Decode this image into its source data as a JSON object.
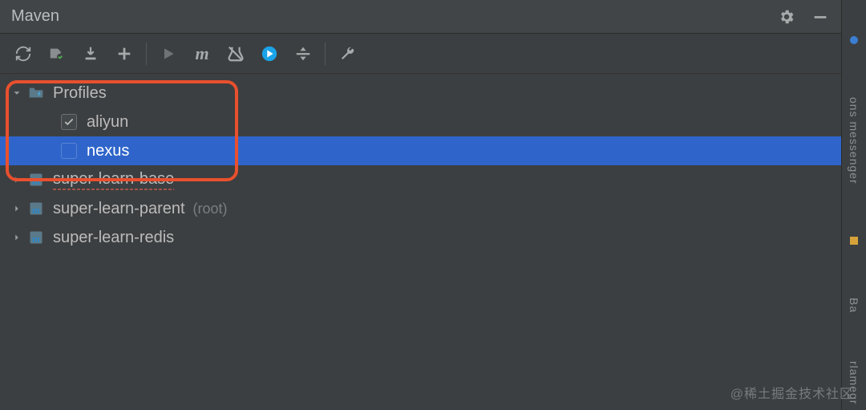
{
  "header": {
    "title": "Maven"
  },
  "toolbar": {
    "items": [
      {
        "name": "reimport-icon"
      },
      {
        "name": "generate-sources-icon"
      },
      {
        "name": "download-icon"
      },
      {
        "name": "add-icon"
      },
      {
        "separator": true
      },
      {
        "name": "run-icon"
      },
      {
        "name": "maven-goal-icon"
      },
      {
        "name": "toggle-skip-tests-icon"
      },
      {
        "name": "offline-mode-icon"
      },
      {
        "name": "collapse-all-icon"
      },
      {
        "separator": true
      },
      {
        "name": "settings-wrench-icon"
      }
    ]
  },
  "tree": {
    "profiles_label": "Profiles",
    "profiles": [
      {
        "label": "aliyun",
        "checked": true
      },
      {
        "label": "nexus",
        "checked": false,
        "selected": true
      }
    ],
    "modules": [
      {
        "label": "super-learn-base",
        "error": true
      },
      {
        "label": "super-learn-parent",
        "root": true
      },
      {
        "label": "super-learn-redis"
      }
    ],
    "root_tag": "(root)"
  },
  "rightbar": {
    "tab1": "ons messenger",
    "tab2": "Ba",
    "tab3": "rlamegr"
  },
  "watermark": "@稀土掘金技术社区"
}
